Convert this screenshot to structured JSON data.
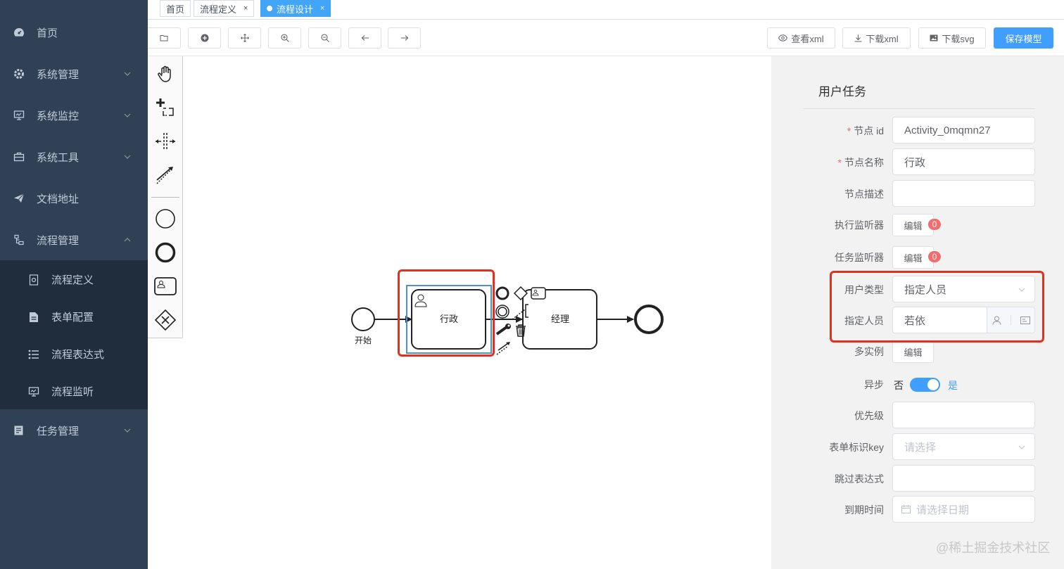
{
  "sidebar": {
    "items": [
      {
        "label": "首页",
        "icon": "dashboard-icon"
      },
      {
        "label": "系统管理",
        "icon": "gear-icon"
      },
      {
        "label": "系统监控",
        "icon": "monitor-icon"
      },
      {
        "label": "系统工具",
        "icon": "toolbox-icon"
      },
      {
        "label": "文档地址",
        "icon": "paper-plane-icon"
      },
      {
        "label": "流程管理",
        "icon": "flow-icon"
      },
      {
        "label": "任务管理",
        "icon": "task-icon"
      }
    ],
    "submenu": [
      {
        "label": "流程定义",
        "icon": "definition-icon"
      },
      {
        "label": "表单配置",
        "icon": "form-icon"
      },
      {
        "label": "流程表达式",
        "icon": "list-icon"
      },
      {
        "label": "流程监听",
        "icon": "monitor-icon"
      }
    ]
  },
  "tabs": [
    {
      "label": "首页",
      "closable": false
    },
    {
      "label": "流程定义",
      "closable": true,
      "close": "×"
    },
    {
      "label": "流程设计",
      "closable": true,
      "close": "×",
      "active": true
    }
  ],
  "toolbar": {
    "icon_buttons": [
      "open-folder-icon",
      "add-circle-icon",
      "move-icon",
      "zoom-in-icon",
      "zoom-out-icon",
      "undo-icon",
      "redo-icon"
    ],
    "view_xml": "查看xml",
    "download_xml": "下载xml",
    "download_svg": "下载svg",
    "save_model": "保存模型"
  },
  "diagram": {
    "start_label": "开始",
    "task1_label": "行政",
    "task2_label": "经理"
  },
  "panel": {
    "title": "用户任务",
    "node_id_label": "节点 id",
    "node_id_value": "Activity_0mqmn27",
    "node_name_label": "节点名称",
    "node_name_value": "行政",
    "node_desc_label": "节点描述",
    "exec_listener_label": "执行监听器",
    "exec_listener_btn": "编辑",
    "exec_listener_count": "0",
    "task_listener_label": "任务监听器",
    "task_listener_btn": "编辑",
    "task_listener_count": "0",
    "user_type_label": "用户类型",
    "user_type_value": "指定人员",
    "assignee_label": "指定人员",
    "assignee_value": "若依",
    "multi_instance_label": "多实例",
    "multi_instance_btn": "编辑",
    "async_label": "异步",
    "async_off": "否",
    "async_on": "是",
    "async_enabled": true,
    "priority_label": "优先级",
    "form_key_label": "表单标识key",
    "form_key_placeholder": "请选择",
    "skip_expr_label": "跳过表达式",
    "due_date_label": "到期时间",
    "due_date_placeholder": "请选择日期"
  },
  "watermark": "@稀土掘金技术社区",
  "colors": {
    "sidebar_bg": "#304156",
    "submenu_bg": "#1f2d3d",
    "primary": "#409eff",
    "highlight": "#e0301e",
    "tab_active": "#42a5f5"
  }
}
